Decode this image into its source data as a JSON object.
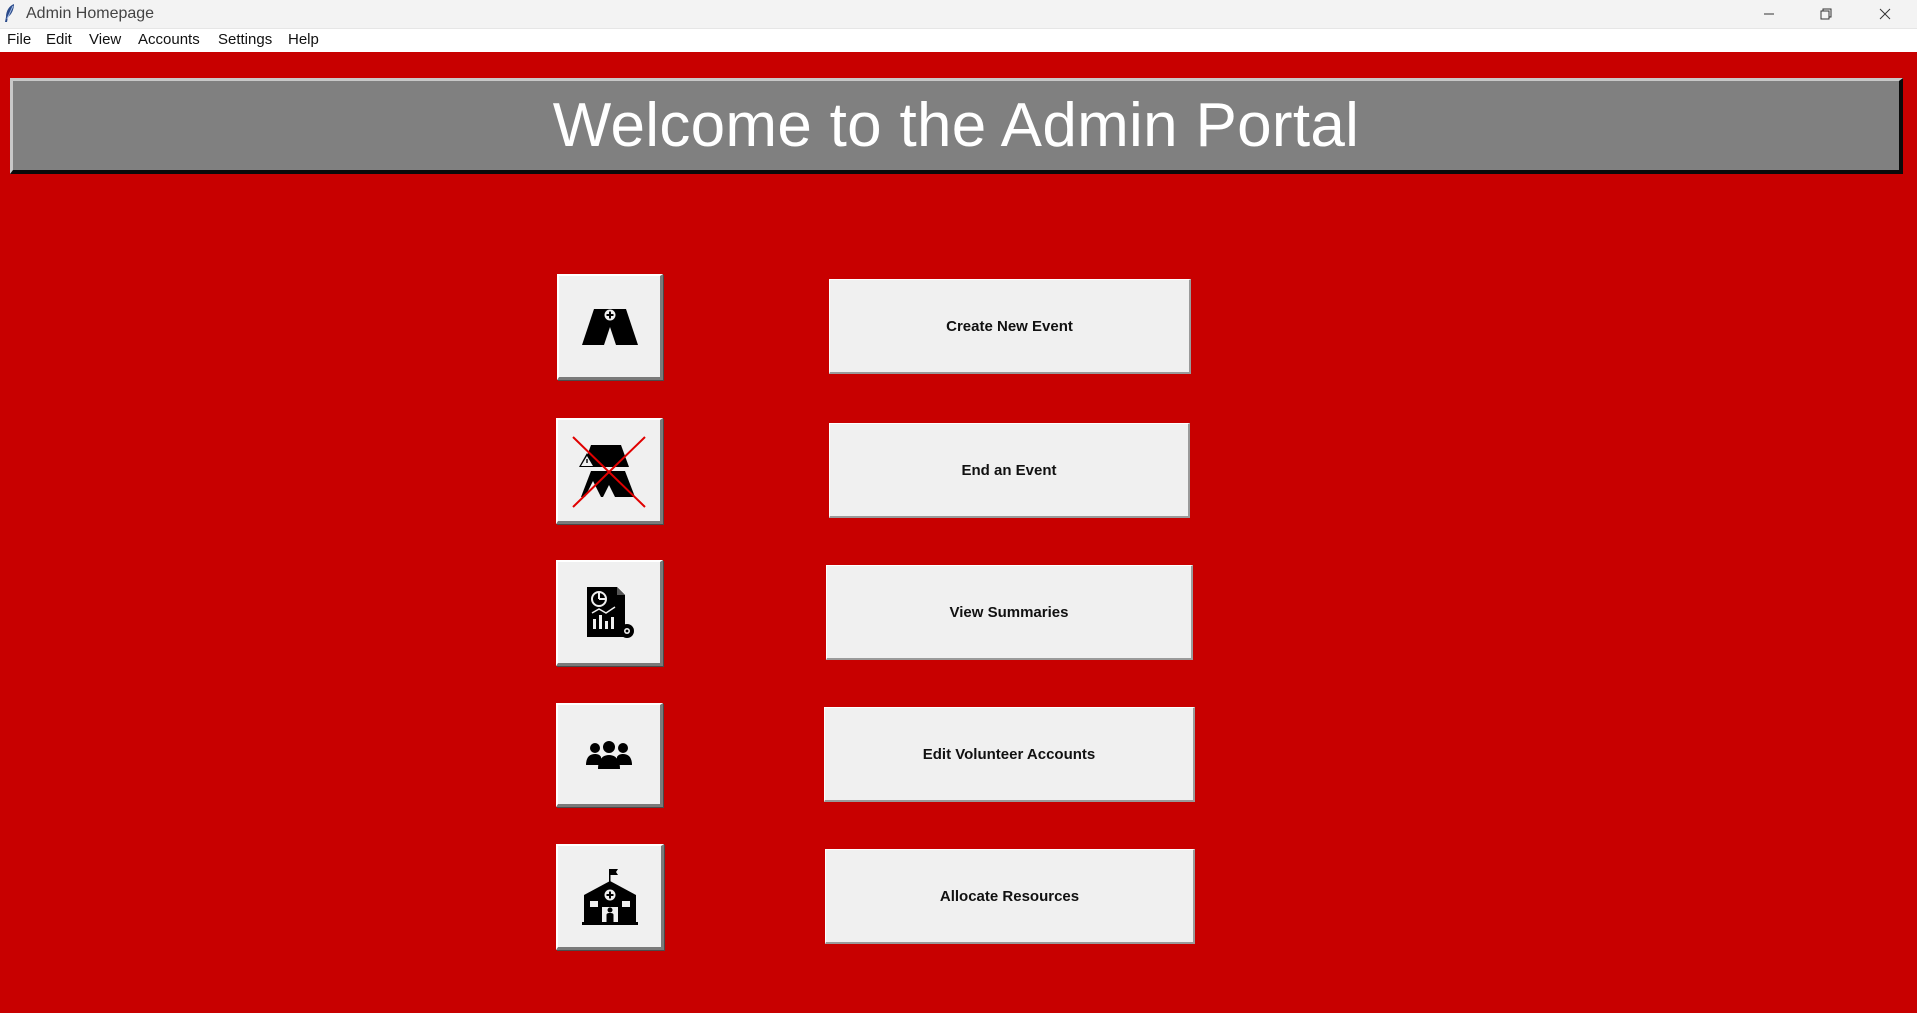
{
  "window": {
    "title": "Admin Homepage",
    "app_icon": "feather-icon",
    "controls": [
      "minimize-icon",
      "restore-icon",
      "close-icon"
    ]
  },
  "menu": {
    "items": [
      {
        "label": "File"
      },
      {
        "label": "Edit"
      },
      {
        "label": "View"
      },
      {
        "label": "Accounts"
      },
      {
        "label": "Settings"
      },
      {
        "label": "Help"
      }
    ]
  },
  "banner": {
    "title": "Welcome to the Admin Portal"
  },
  "actions": [
    {
      "label": "Create New Event",
      "icon": "tent-medical-icon"
    },
    {
      "label": "End an Event",
      "icon": "end-event-crossed-icon"
    },
    {
      "label": "View Summaries",
      "icon": "report-chart-icon"
    },
    {
      "label": "Edit Volunteer Accounts",
      "icon": "users-group-icon"
    },
    {
      "label": "Allocate Resources",
      "icon": "shelter-building-icon"
    }
  ],
  "colors": {
    "background": "#c80000",
    "banner": "#808080",
    "button": "#f0f0f0",
    "banner_text": "#ffffff"
  }
}
